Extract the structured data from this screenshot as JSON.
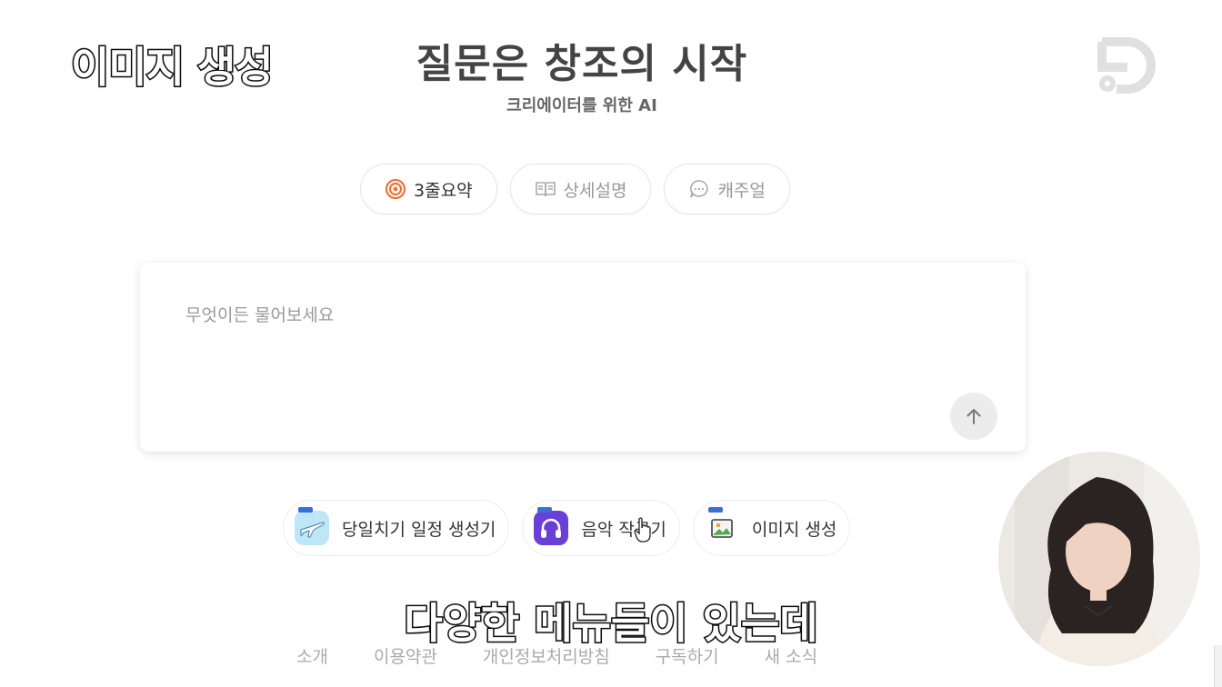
{
  "overlay": {
    "title": "이미지 생성",
    "caption": "다양한 메뉴들이 있는데"
  },
  "hero": {
    "title": "질문은 창조의 시작",
    "subtitle": "크리에이터를 위한 AI"
  },
  "modes": [
    {
      "label": "3줄요약",
      "icon": "target-icon",
      "active": true
    },
    {
      "label": "상세설명",
      "icon": "book-icon",
      "active": false
    },
    {
      "label": "캐주얼",
      "icon": "chat-bubble-icon",
      "active": false
    }
  ],
  "ask": {
    "placeholder": "무엇이든 물어보세요",
    "value": ""
  },
  "tools": [
    {
      "label": "당일치기 일정 생성기",
      "icon": "airplane-icon"
    },
    {
      "label": "음악 작곡기",
      "icon": "headphones-icon"
    },
    {
      "label": "이미지 생성",
      "icon": "image-icon"
    }
  ],
  "footer": [
    "소개",
    "이용약관",
    "개인정보처리방침",
    "구독하기",
    "새 소식"
  ],
  "colors": {
    "accent": "#e8743b",
    "headphones_bg": "#6a3fd6",
    "airplane_bg": "#bfe6f6",
    "send_bg": "#ececec"
  }
}
